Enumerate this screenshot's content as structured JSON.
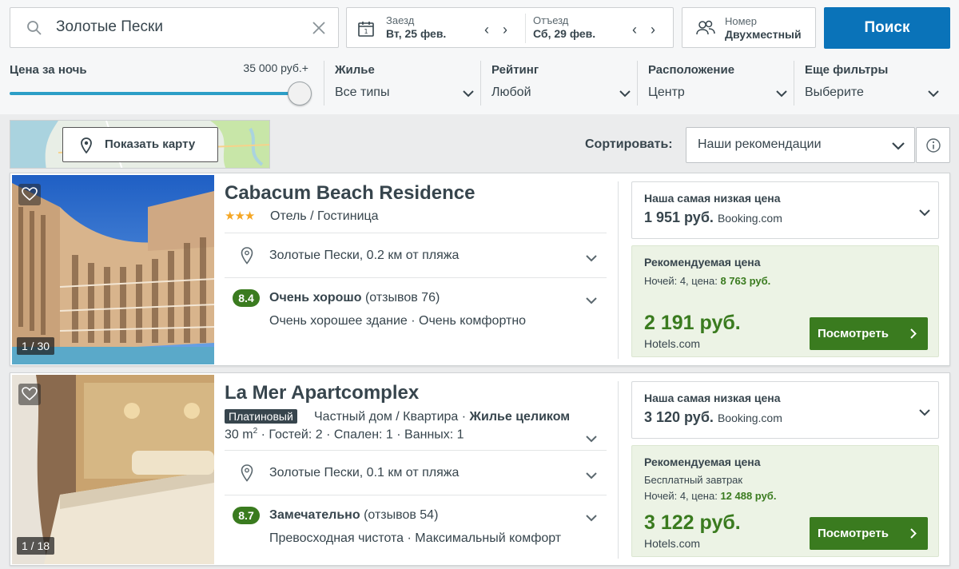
{
  "search": {
    "destination": "Золотые Пески",
    "checkin_label": "Заезд",
    "checkin_value": "Вт, 25 фев.",
    "checkout_label": "Отъезд",
    "checkout_value": "Сб, 29 фев.",
    "nav_arrows": "‹ ›",
    "room_label": "Номер",
    "room_value": "Двухместный",
    "search_button": "Поиск"
  },
  "filters": {
    "price_title": "Цена за ночь",
    "price_max": "35 000 руб.+",
    "price_slider_fraction": 1.0,
    "items": [
      {
        "title": "Жилье",
        "value": "Все типы"
      },
      {
        "title": "Рейтинг",
        "value": "Любой"
      },
      {
        "title": "Расположение",
        "value": "Центр"
      },
      {
        "title": "Еще фильтры",
        "value": "Выберите"
      }
    ]
  },
  "map": {
    "show_map": "Показать карту"
  },
  "sort": {
    "label": "Сортировать:",
    "value": "Наши рекомендации"
  },
  "hotels": [
    {
      "name": "Cabacum Beach Residence",
      "stars": "★★★",
      "type": "Отель / Гостиница",
      "location": "Золотые Пески, 0.2 км от пляжа",
      "rating": "8.4",
      "rating_text": "Очень хорошо",
      "reviews": "(отзывов 76)",
      "highlights": "Очень хорошее здание · Очень комфортно",
      "photo_counter": "1 / 30",
      "lowest_title": "Наша самая низкая цена",
      "lowest_price": "1 951 руб.",
      "lowest_source": "Booking.com",
      "rec_title": "Рекомендуемая цена",
      "nights_prefix": "Ночей: 4, цена: ",
      "nights_total": "8 763 руб.",
      "rec_price": "2 191 руб.",
      "rec_source": "Hotels.com",
      "view_button": "Посмотреть"
    },
    {
      "name": "La Mer Apartcomplex",
      "badge": "Платиновый",
      "type_text": "Частный дом / Квартира · ",
      "type_bold": "Жилье целиком",
      "area": "30 m",
      "area_sup": "2",
      "details": " · Гостей: 2 · Спален: 1 · Ванных: 1",
      "location": "Золотые Пески, 0.1 км от пляжа",
      "rating": "8.7",
      "rating_text": "Замечательно",
      "reviews": "(отзывов 54)",
      "highlights": "Превосходная чистота · Максимальный комфорт",
      "photo_counter": "1 / 18",
      "lowest_title": "Наша самая низкая цена",
      "lowest_price": "3 120 руб.",
      "lowest_source": "Booking.com",
      "rec_title": "Рекомендуемая цена",
      "perk": "Бесплатный завтрак",
      "nights_prefix": "Ночей: 4, цена: ",
      "nights_total": "12 488 руб.",
      "rec_price": "3 122 руб.",
      "rec_source": "Hotels.com",
      "view_button": "Посмотреть"
    }
  ],
  "colors": {
    "search_button": "#0a73b9",
    "rating_badge": "#3a7b1f",
    "view_button": "#3a7b1f",
    "recommended_bg": "#ecf3e5",
    "slider": "#2c9ec7",
    "stars": "#f5a623"
  },
  "icons": [
    "search-icon",
    "clear-icon",
    "calendar-icon",
    "guests-icon",
    "map-pin-icon",
    "chevron-down-icon",
    "info-icon",
    "heart-icon",
    "location-pin-icon",
    "chevron-right-icon"
  ]
}
